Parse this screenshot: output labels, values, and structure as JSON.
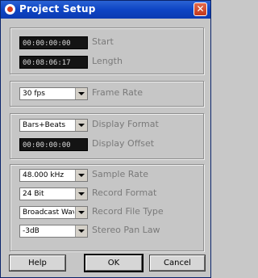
{
  "window": {
    "title": "Project Setup",
    "close_glyph": "✕"
  },
  "timing": {
    "start": {
      "value": "00:00:00:00",
      "label": "Start"
    },
    "length": {
      "value": "00:08:06:17",
      "label": "Length"
    }
  },
  "frame": {
    "frame_rate": {
      "value": "30 fps",
      "label": "Frame Rate"
    }
  },
  "display": {
    "format": {
      "value": "Bars+Beats",
      "label": "Display Format"
    },
    "offset": {
      "value": "00:00:00:00",
      "label": "Display Offset"
    }
  },
  "audio": {
    "sample_rate": {
      "value": "48.000 kHz",
      "label": "Sample Rate"
    },
    "record_format": {
      "value": "24 Bit",
      "label": "Record Format"
    },
    "record_file_type": {
      "value": "Broadcast Wave",
      "label": "Record File Type"
    },
    "stereo_pan_law": {
      "value": "-3dB",
      "label": "Stereo Pan Law"
    }
  },
  "buttons": {
    "help": "Help",
    "ok": "OK",
    "cancel": "Cancel"
  },
  "colors": {
    "titlebar": "#0e45c4",
    "field_bg": "#141414",
    "dialog_bg": "#c6c6c6"
  }
}
